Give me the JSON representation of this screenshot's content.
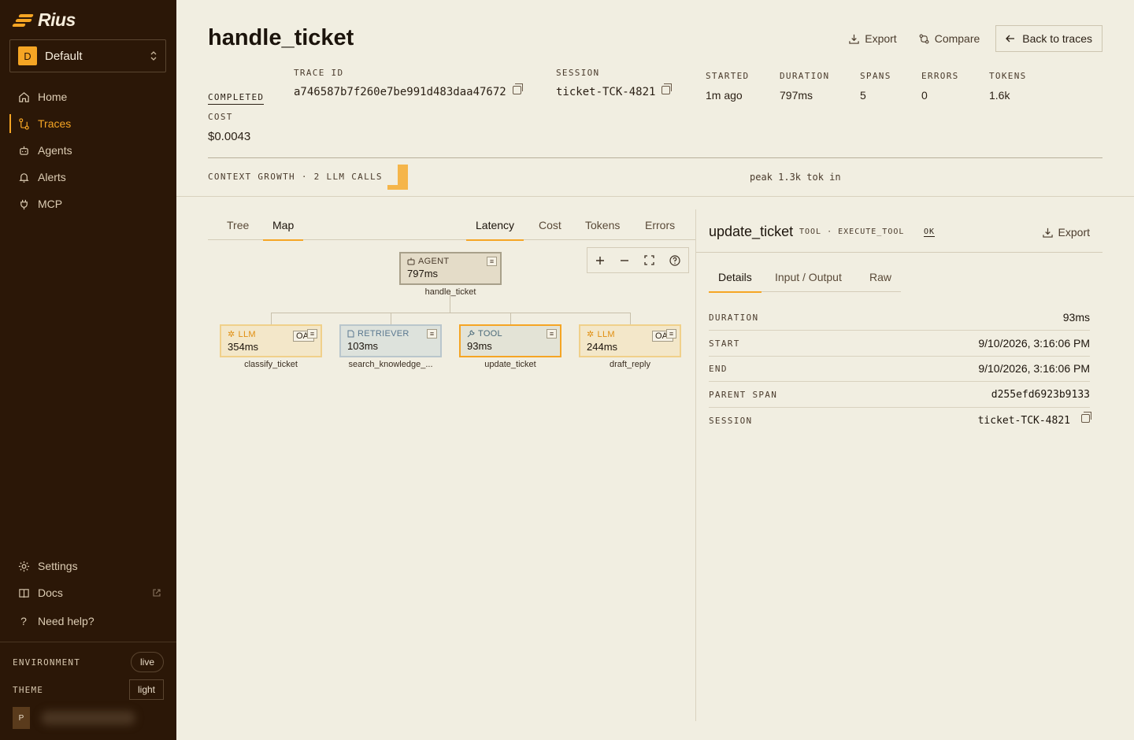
{
  "app": {
    "logo_text": "Rius"
  },
  "workspace": {
    "badge": "D",
    "name": "Default"
  },
  "nav": [
    {
      "label": "Home",
      "icon": "home-icon"
    },
    {
      "label": "Traces",
      "icon": "traces-icon",
      "active": true
    },
    {
      "label": "Agents",
      "icon": "agent-icon"
    },
    {
      "label": "Alerts",
      "icon": "bell-icon"
    },
    {
      "label": "MCP",
      "icon": "plug-icon"
    }
  ],
  "nav_bottom": [
    {
      "label": "Settings",
      "icon": "gear-icon"
    },
    {
      "label": "Docs",
      "icon": "book-icon"
    },
    {
      "label": "Need help?",
      "icon": "question-icon"
    }
  ],
  "environment": {
    "label": "ENVIRONMENT",
    "value": "live"
  },
  "theme": {
    "label": "THEME",
    "value": "light"
  },
  "user": {
    "initial": "P"
  },
  "header": {
    "title": "handle_ticket",
    "export": "Export",
    "compare": "Compare",
    "back": "Back to traces"
  },
  "trace": {
    "status": "COMPLETED",
    "trace_id_label": "TRACE ID",
    "trace_id": "a746587b7f260e7be991d483daa47672",
    "session_label": "SESSION",
    "session": "ticket-TCK-4821",
    "started_label": "STARTED",
    "started": "1m ago",
    "duration_label": "DURATION",
    "duration": "797ms",
    "spans_label": "SPANS",
    "spans": "5",
    "errors_label": "ERRORS",
    "errors": "0",
    "tokens_label": "TOKENS",
    "tokens": "1.6k",
    "cost_label": "COST",
    "cost": "$0.0043"
  },
  "context": {
    "label": "CONTEXT GROWTH · 2 LLM CALLS",
    "peak": "peak 1.3k tok in",
    "bar_color": "#f5b54a"
  },
  "view_tabs": [
    "Tree",
    "Map"
  ],
  "active_view_tab": "Map",
  "metric_tabs": [
    "Latency",
    "Cost",
    "Tokens",
    "Errors"
  ],
  "active_metric_tab": "Latency",
  "map": {
    "root": {
      "kind": "AGENT",
      "value": "797ms",
      "name": "handle_ticket"
    },
    "children": [
      {
        "kind": "LLM",
        "value": "354ms",
        "name": "classify_ticket",
        "provider": "OAI"
      },
      {
        "kind": "RETRIEVER",
        "value": "103ms",
        "name": "search_knowledge_..."
      },
      {
        "kind": "TOOL",
        "value": "93ms",
        "name": "update_ticket",
        "selected": true
      },
      {
        "kind": "LLM",
        "value": "244ms",
        "name": "draft_reply",
        "provider": "OAI"
      }
    ]
  },
  "detail": {
    "title": "update_ticket",
    "tags": "TOOL · EXECUTE_TOOL",
    "status": "OK",
    "export": "Export",
    "tabs": [
      "Details",
      "Input / Output",
      "Raw"
    ],
    "active_tab": "Details",
    "rows": [
      {
        "key": "DURATION",
        "value": "93ms"
      },
      {
        "key": "START",
        "value": "9/10/2026, 3:16:06 PM"
      },
      {
        "key": "END",
        "value": "9/10/2026, 3:16:06 PM"
      },
      {
        "key": "PARENT SPAN",
        "value": "d255efd6923b9133"
      },
      {
        "key": "SESSION",
        "value": "ticket-TCK-4821"
      }
    ]
  },
  "colors": {
    "accent": "#f5a524",
    "sidebar_bg": "#2b1707",
    "llm": "#f5a524",
    "retriever": "#6b8aa8",
    "tool": "#4a6a7a"
  }
}
